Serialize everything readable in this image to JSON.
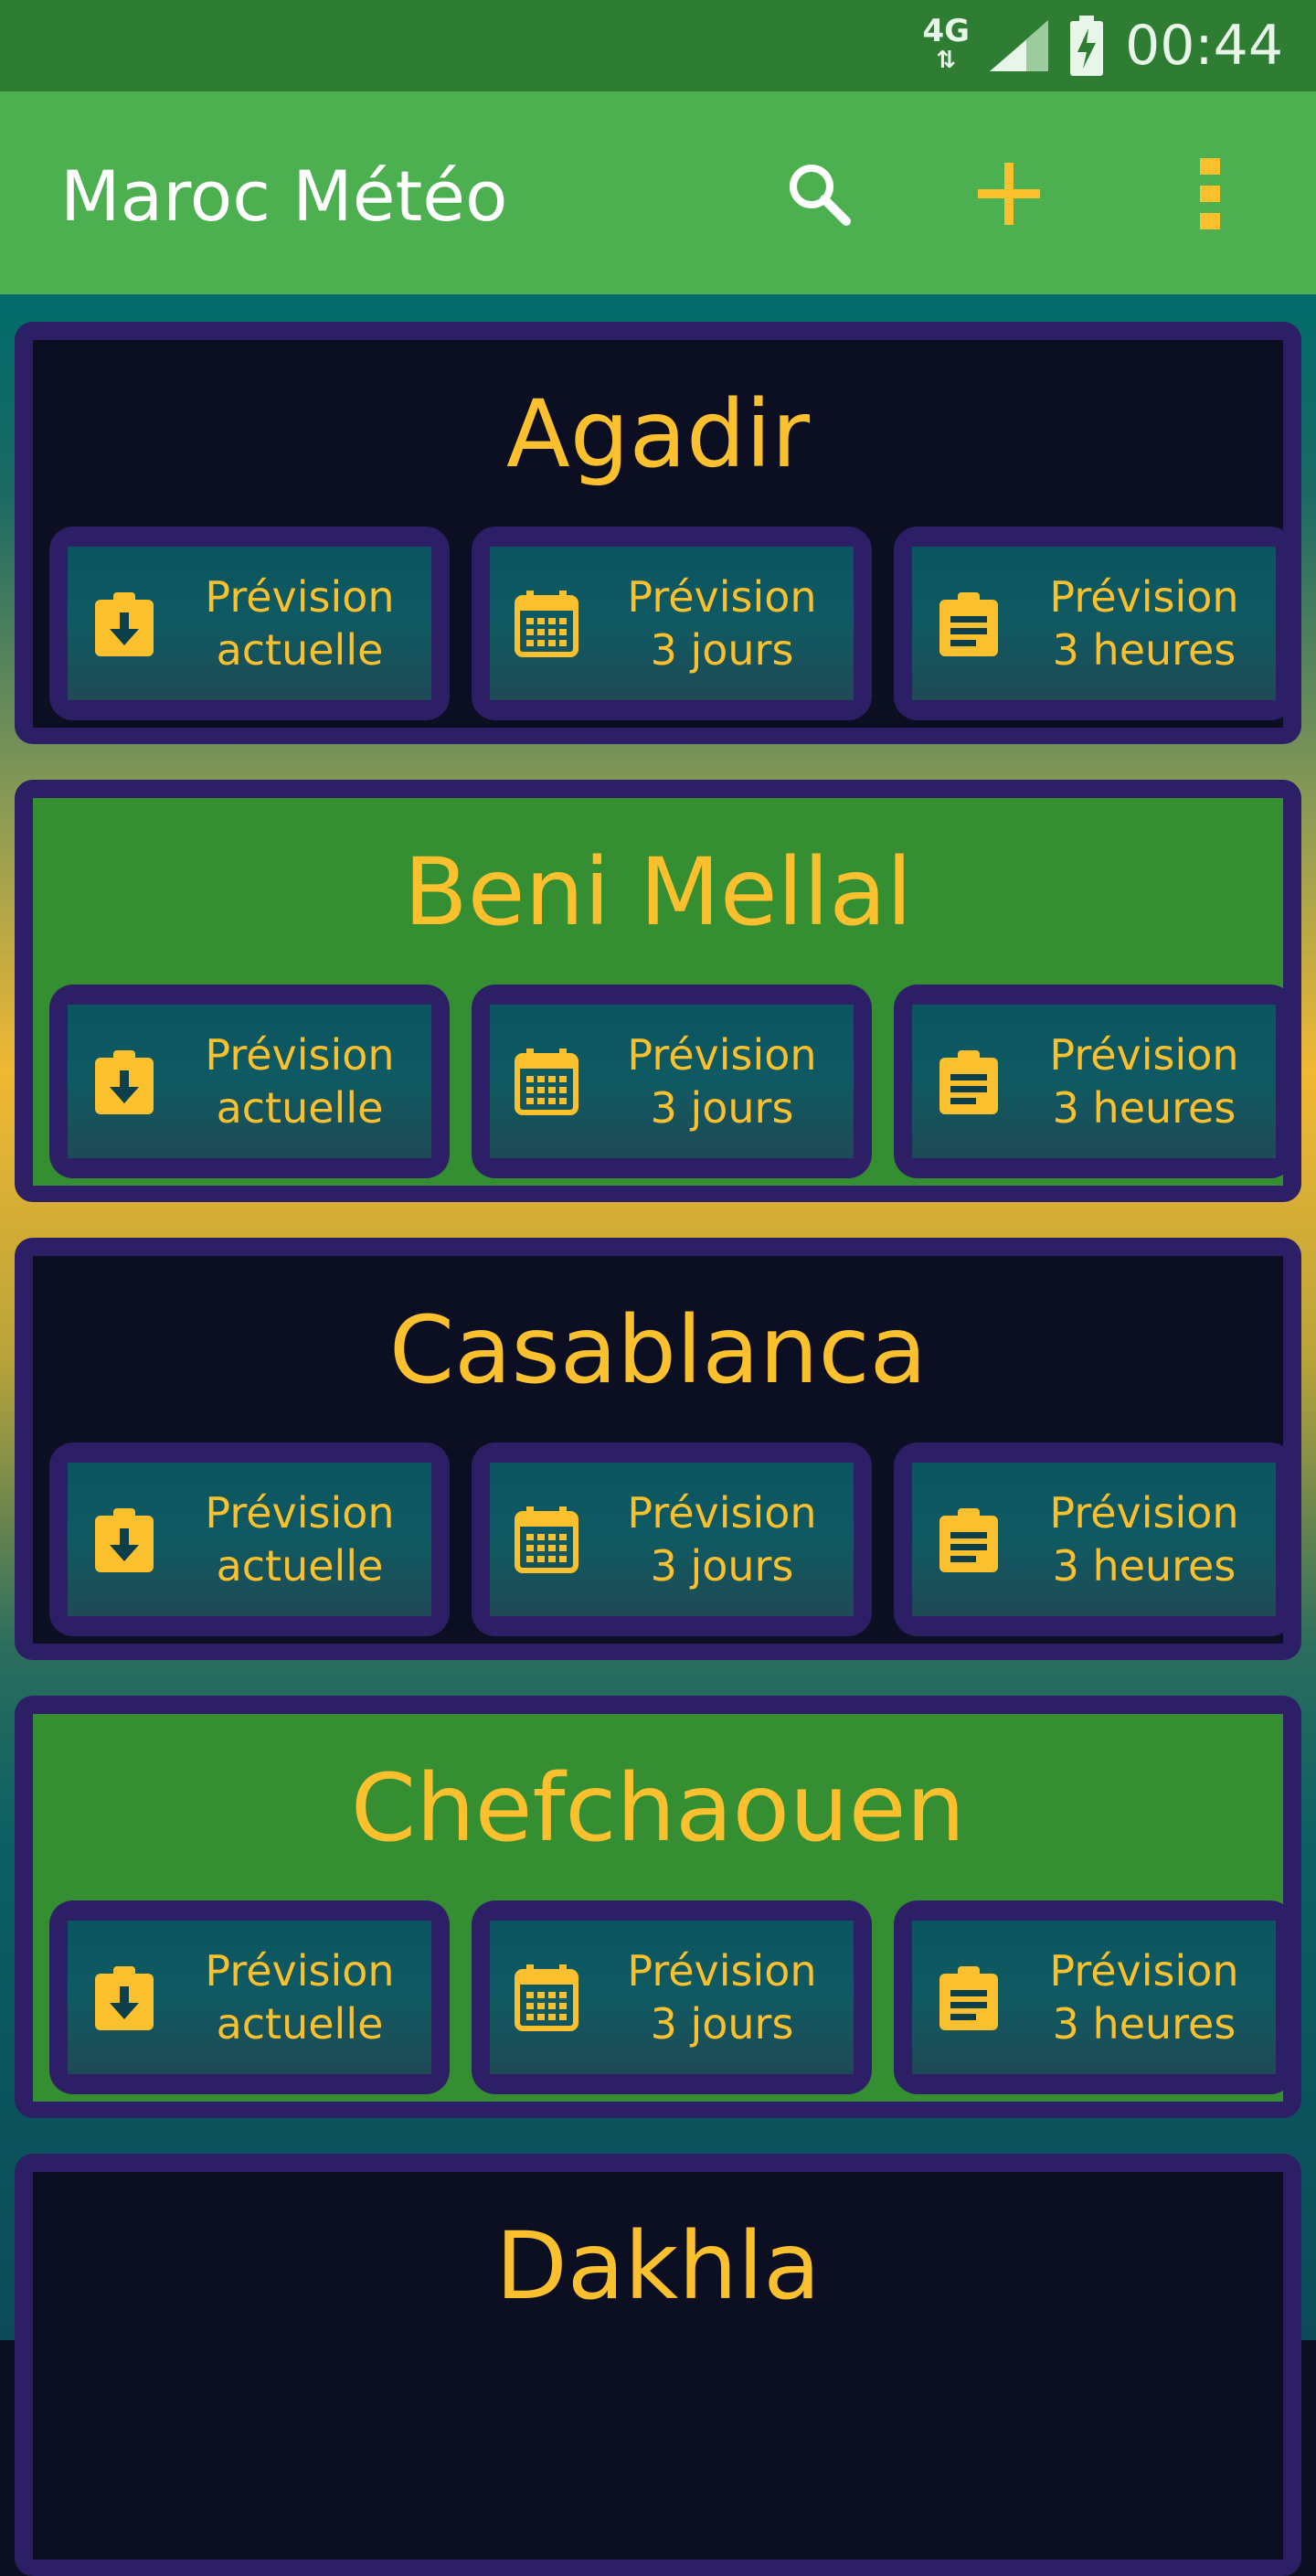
{
  "status_bar": {
    "network": "4G",
    "time": "00:44"
  },
  "app_bar": {
    "title": "Maroc Météo"
  },
  "buttons": {
    "current": {
      "line1": "Prévision",
      "line2": "actuelle"
    },
    "three_days": {
      "line1": "Prévision",
      "line2": "3 jours"
    },
    "three_hours": {
      "line1": "Prévision",
      "line2": "3 heures"
    }
  },
  "cities": [
    {
      "name": "Agadir"
    },
    {
      "name": "Beni Mellal"
    },
    {
      "name": "Casablanca"
    },
    {
      "name": "Chefchaouen"
    },
    {
      "name": "Dakhla"
    }
  ],
  "colors": {
    "accent": "#fbc02d",
    "app_bar": "#4caf50",
    "status_bar": "#2e7d32",
    "card_border": "#2c1f66",
    "card_dark": "#0c0f22",
    "card_green": "#368e32"
  }
}
